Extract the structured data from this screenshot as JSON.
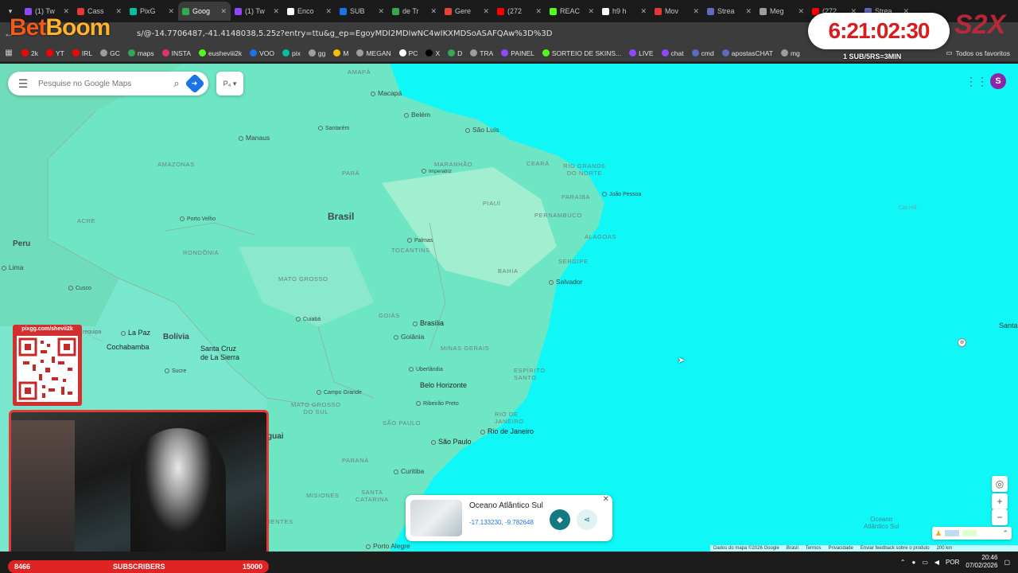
{
  "browser": {
    "tabs": [
      {
        "label": "(1) Tw",
        "color": "#9146ff"
      },
      {
        "label": "Cass",
        "color": "#e53935"
      },
      {
        "label": "PixG",
        "color": "#00bfa5"
      },
      {
        "label": "Goog",
        "color": "#34a853",
        "active": true
      },
      {
        "label": "(1) Tw",
        "color": "#9146ff"
      },
      {
        "label": "Enco",
        "color": "#ffffff"
      },
      {
        "label": "SUB",
        "color": "#1a73e8"
      },
      {
        "label": "de Tr",
        "color": "#34a853"
      },
      {
        "label": "Gere",
        "color": "#ea4335"
      },
      {
        "label": "(272",
        "color": "#ff0000"
      },
      {
        "label": "REAC",
        "color": "#53fc18"
      },
      {
        "label": "h9 h",
        "color": "#ffffff"
      },
      {
        "label": "Mov",
        "color": "#e53935"
      },
      {
        "label": "Strea",
        "color": "#5c6bc0"
      },
      {
        "label": "Meg",
        "color": "#9e9e9e"
      },
      {
        "label": "(272",
        "color": "#ff0000"
      },
      {
        "label": "Strea",
        "color": "#5c6bc0"
      }
    ],
    "url": "s/@-14.7706487,-41.4148038,5.25z?entry=ttu&g_ep=EgoyMDI2MDIwNC4wIKXMDSoASAFQAw%3D%3D",
    "bookmarks": [
      {
        "label": "2k",
        "color": "#ff0000"
      },
      {
        "label": "YT",
        "color": "#ff0000"
      },
      {
        "label": "IRL",
        "color": "#ff0000"
      },
      {
        "label": "GC",
        "color": "#9e9e9e"
      },
      {
        "label": "maps",
        "color": "#34a853"
      },
      {
        "label": "INSTA",
        "color": "#e1306c"
      },
      {
        "label": "eusheviii2k",
        "color": "#53fc18"
      },
      {
        "label": "VOO",
        "color": "#1a73e8"
      },
      {
        "label": "pix",
        "color": "#00bfa5"
      },
      {
        "label": "gg",
        "color": "#9e9e9e"
      },
      {
        "label": "M",
        "color": "#fbbc04"
      },
      {
        "label": "MEGAN",
        "color": "#9e9e9e"
      },
      {
        "label": "PC",
        "color": "#ffffff"
      },
      {
        "label": "X",
        "color": "#000000"
      },
      {
        "label": "D",
        "color": "#34a853"
      },
      {
        "label": "TRA",
        "color": "#9e9e9e"
      },
      {
        "label": "PAINEL",
        "color": "#9146ff"
      },
      {
        "label": "SORTEIO DE SKINS...",
        "color": "#53fc18"
      },
      {
        "label": "LIVE",
        "color": "#9146ff"
      },
      {
        "label": "chat",
        "color": "#9146ff"
      },
      {
        "label": "cmd",
        "color": "#5c6bc0"
      },
      {
        "label": "apostasCHAT",
        "color": "#5c6bc0"
      },
      {
        "label": "mg",
        "color": "#9e9e9e"
      }
    ],
    "all_bookmarks": "Todos os favoritos"
  },
  "maps": {
    "search_placeholder": "Pesquise no Google Maps",
    "layers_label": "P₄",
    "avatar_letter": "S",
    "labels": {
      "amapa": "AMAPÁ",
      "macapa": "Macapá",
      "belem": "Belém",
      "sao_luis": "São Luís",
      "santarem": "Santarém",
      "manaus": "Manaus",
      "amazonas": "AMAZONAS",
      "para": "PARÁ",
      "maranhao": "MARANHÃO",
      "imperatriz": "Imperatriz",
      "ceara": "CEARÁ",
      "rio_grande_do_norte": "RIO GRANDE DO NORTE",
      "paraiba": "PARAÍBA",
      "joao_pessoa": "João Pessoa",
      "piaui": "PIAUÍ",
      "pernambuco": "PERNAMBUCO",
      "acre": "ACRE",
      "porto_velho": "Porto Velho",
      "brasil": "Brasil",
      "alagoas": "ALAGOAS",
      "peru": "Peru",
      "rondonia": "RONDÔNIA",
      "palmas": "Palmas",
      "tocantins": "TOCANTINS",
      "sergipe": "SERGIPE",
      "lima": "Lima",
      "mato_grosso": "MATO GROSSO",
      "bahia": "BAHIA",
      "salvador": "Salvador",
      "cusco": "Cusco",
      "cuiaba": "Cuiabá",
      "goias": "GOIÁS",
      "brasilia": "Brasília",
      "la_paz": "La Paz",
      "bolivia": "Bolívia",
      "goiania": "Goiânia",
      "cochabamba": "Cochabamba",
      "minas_gerais": "MINAS GERAIS",
      "santa_cruz": "Santa Cruz\nde La Sierra",
      "sucre": "Sucre",
      "uberlandia": "Uberlândia",
      "espirito_santo": "ESPÍRITO\nSANTO",
      "belo_horizonte": "Belo Horizonte",
      "campo_grande": "Campo Grande",
      "ribeirao_preto": "Ribeirão Preto",
      "mato_grosso_do_sul": "MATO GROSSO\nDO SUL",
      "rio_de_janeiro_state": "RIO DE\nJANEIRO",
      "rio_de_janeiro": "Rio de Janeiro",
      "sao_paulo_state": "SÃO PAULO",
      "sao_paulo": "São Paulo",
      "paraguai": "guai",
      "parana": "PARANÁ",
      "curitiba": "Curitiba",
      "misiones": "MISIONES",
      "santa_catarina": "SANTA\nCATARINA",
      "corrientes": "IENTES",
      "porto_alegre": "Porto Alegre",
      "cat_hill": "Cat Hill",
      "santa": "Santa",
      "requipa": "requipa",
      "ocean": "Oceano\nAtlântico Sul"
    },
    "place_card": {
      "title": "Oceano Atlântico Sul",
      "coords": "-17.133230, -9.782648"
    },
    "footer": [
      "Dados do mapa ©2026 Google",
      "Brasil",
      "Termos",
      "Privacidade",
      "Enviar feedback sobre o produto",
      "200 km"
    ]
  },
  "overlay": {
    "betboom_1": "Bet",
    "betboom_2": "Boom",
    "timer": "6:21:02:30",
    "timer_sub": "1 SUB/5RS=3MIN",
    "brand": "S2X",
    "qr_text": "pixgg.com/shevii2k",
    "subs_left": "8466",
    "subs_title": "SUBSCRIBERS",
    "subs_right": "15000"
  },
  "taskbar": {
    "lang": "POR",
    "time": "20:46",
    "date": "07/02/2026"
  }
}
